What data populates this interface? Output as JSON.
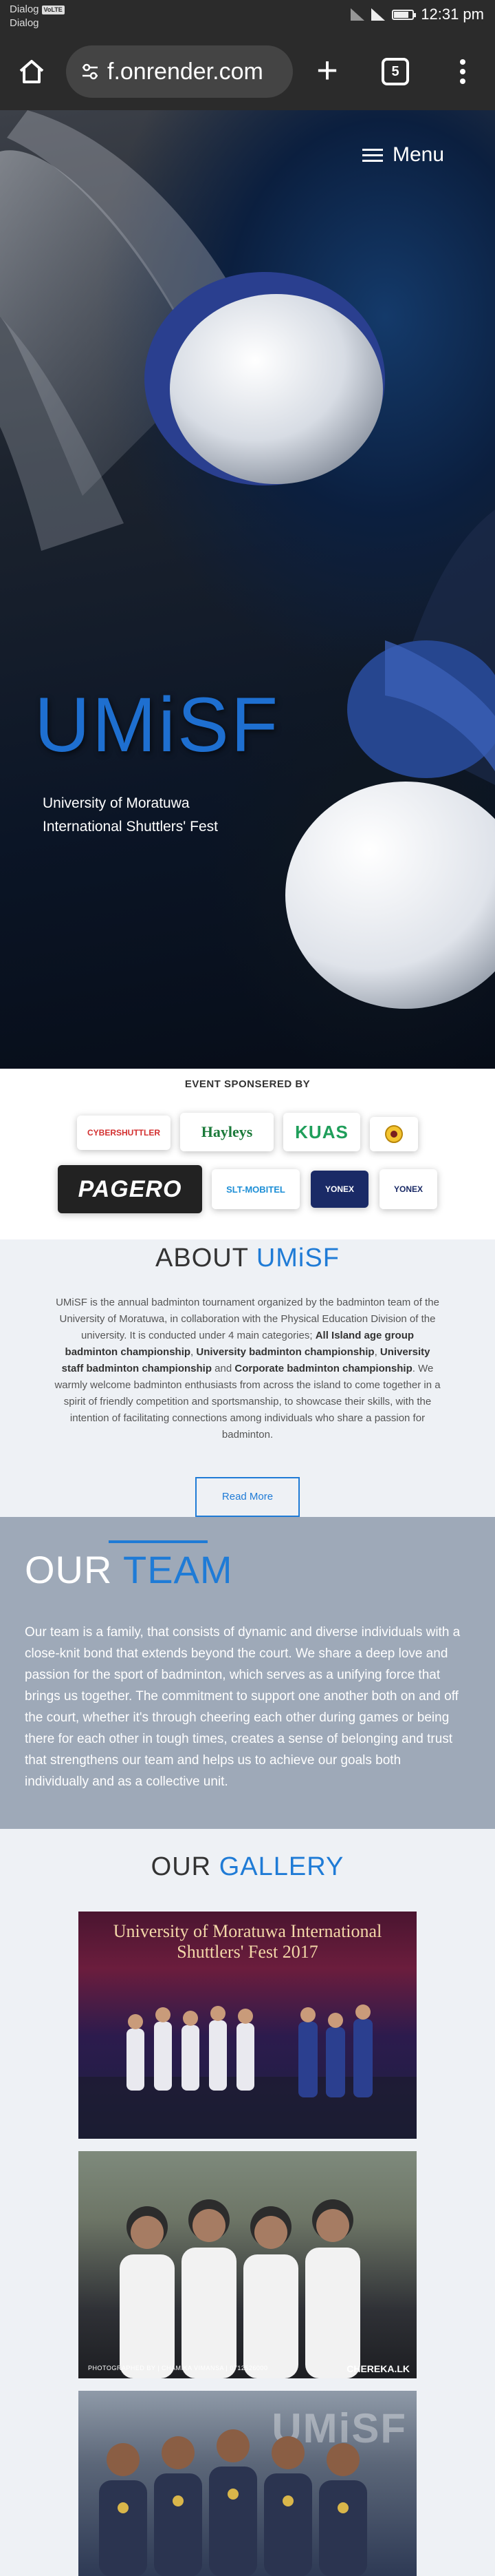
{
  "status_bar": {
    "carrier_line1": "Dialog",
    "volte_badge": "VoLTE",
    "carrier_line2": "Dialog",
    "time": "12:31 pm",
    "battery_level": 0.8
  },
  "browser": {
    "url": "f.onrender.com",
    "tab_count": "5",
    "icons": [
      "home-icon",
      "tune-icon",
      "plus-icon",
      "tabs-icon",
      "kebab-menu-icon"
    ]
  },
  "hero": {
    "menu_label": "Menu",
    "title": "UMiSF",
    "subtitle_line1": "University of Moratuwa",
    "subtitle_line2": "International Shuttlers' Fest"
  },
  "sponsors": {
    "heading": "EVENT SPONSERED BY",
    "logos": [
      {
        "name": "CYBERSHUTTLER",
        "color": "#d32f2f"
      },
      {
        "name": "Hayleys",
        "color": "#1b7a3a"
      },
      {
        "name": "KUAS",
        "color": "#1f9e5a"
      },
      {
        "name": "PAGERO",
        "color": "#ffffff"
      },
      {
        "name": "SLT-MOBITEL",
        "color": "#1e8fd6"
      },
      {
        "name": "YONEX",
        "color": "#ffffff"
      },
      {
        "name": "YONEX",
        "color": "#1a2a66"
      }
    ]
  },
  "about": {
    "heading_plain": "ABOUT",
    "heading_accent": "UMiSF",
    "p1": "UMiSF is the annual badminton tournament organized by the badminton team of the University of Moratuwa, in collaboration with the Physical Education Division of the university. It is conducted under 4 main categories; ",
    "b1": "All Island age group badminton championship",
    "s1": ", ",
    "b2": "University badminton championship",
    "s2": ", ",
    "b3": "University staff badminton championship",
    "s3": " and ",
    "b4": "Corporate badminton championship",
    "p2": ". We warmly welcome badminton enthusiasts from across the island to come together in a spirit of friendly competition and sportsmanship, to showcase their skills, with the intention of facilitating connections among individuals who share a passion for badminton.",
    "read_more": "Read More"
  },
  "team": {
    "heading_plain": "OUR",
    "heading_accent": "TEAM",
    "text": "Our team is a family, that consists of dynamic and diverse individuals with a close-knit bond that extends beyond the court. We share a deep love and passion for the sport of badminton, which serves as a unifying force that brings us together. The commitment to support one another both on and off the court, whether it's through cheering each other during games or being there for each other in tough times, creates a sense of belonging and trust that strengthens our team and helps us to achieve our goals both individually and as a collective unit."
  },
  "gallery": {
    "heading_plain": "OUR",
    "heading_accent": "GALLERY",
    "photo1_banner": "University of Moratuwa International Shuttlers' Fest 2017",
    "photo2_caption": "PHOTOGRAPHED BY | CHAMIKA VIMANSA | 0712526000",
    "photo2_brand": "CHEREKA.LK",
    "photo3_overlay": "UMiSF"
  },
  "colors": {
    "accent": "#1f7bd6",
    "team_bg": "#9ea9b8",
    "page_bg": "#eef1f5"
  }
}
